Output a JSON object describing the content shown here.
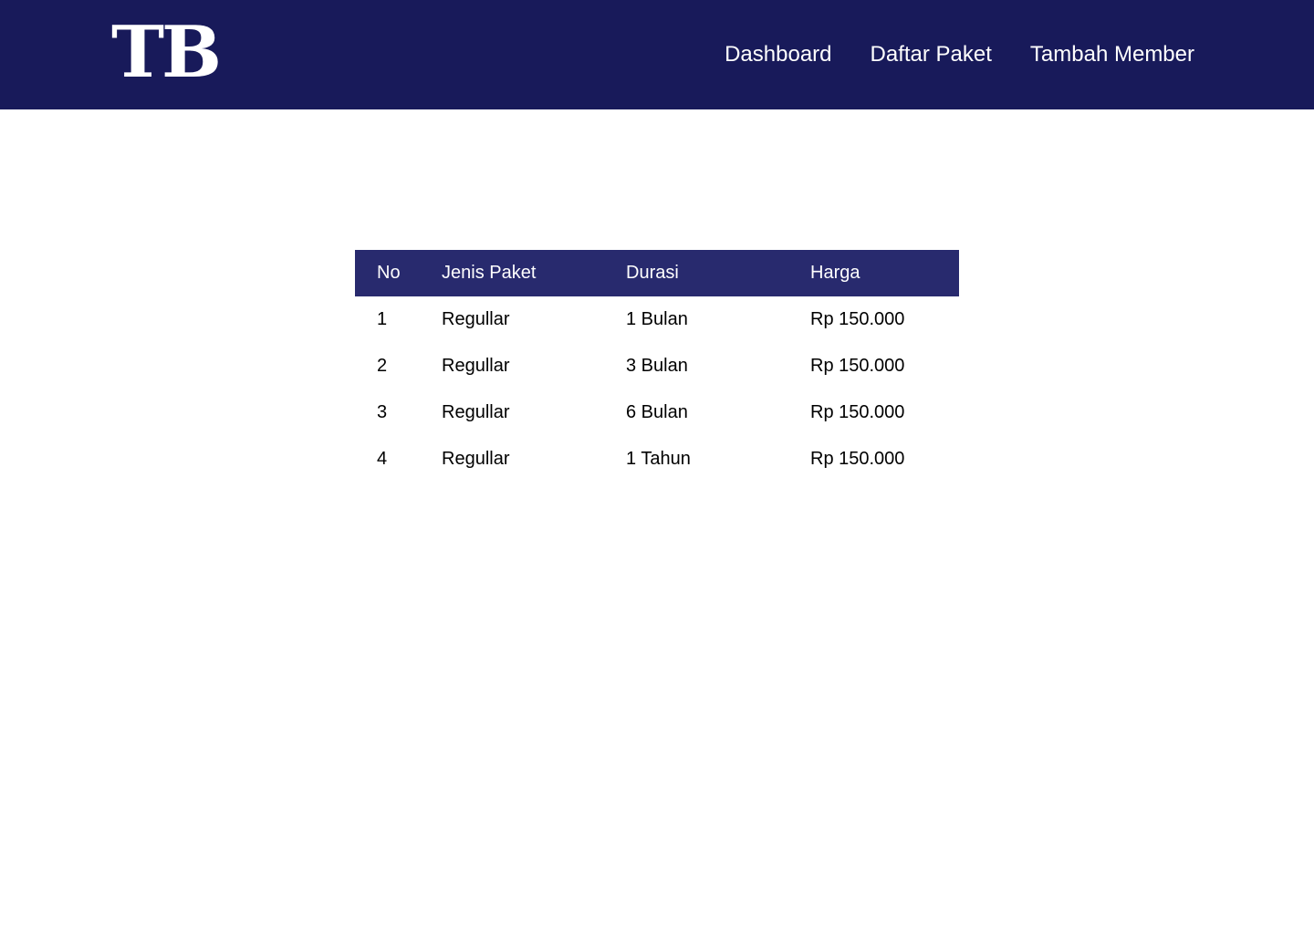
{
  "brand": {
    "logo_text": "TB"
  },
  "nav": {
    "items": [
      {
        "label": "Dashboard"
      },
      {
        "label": "Daftar Paket"
      },
      {
        "label": "Tambah Member"
      }
    ]
  },
  "colors": {
    "navbar_bg": "#181a5a",
    "table_header_bg": "#282a6e"
  },
  "table": {
    "headers": [
      "No",
      "Jenis Paket",
      "Durasi",
      "Harga"
    ],
    "rows": [
      [
        "1",
        "Regullar",
        "1 Bulan",
        "Rp 150.000"
      ],
      [
        "2",
        "Regullar",
        "3 Bulan",
        "Rp 150.000"
      ],
      [
        "3",
        "Regullar",
        "6 Bulan",
        "Rp 150.000"
      ],
      [
        "4",
        "Regullar",
        "1 Tahun",
        "Rp 150.000"
      ]
    ]
  }
}
